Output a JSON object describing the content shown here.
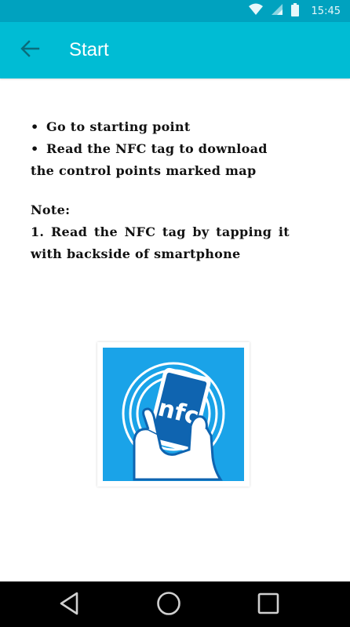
{
  "status_bar": {
    "time": "15:45",
    "icons": [
      "wifi-icon",
      "signal-icon",
      "battery-icon"
    ],
    "background": "#00a2bf"
  },
  "app_bar": {
    "title": "Start",
    "back_icon": "arrow-left-icon",
    "background": "#00bcd4"
  },
  "instructions": {
    "bullets": [
      {
        "bullet": "•",
        "line1": "Go to starting point",
        "line2": ""
      },
      {
        "bullet": "•",
        "line1": "Read the NFC tag to download",
        "line2": "the control points marked map"
      }
    ],
    "note_title": "Note:",
    "note_items": [
      "1. Read the NFC tag by tapping it with backside of smartphone"
    ]
  },
  "nfc_logo": {
    "text": "nfc",
    "background": "#1aa3e8"
  },
  "nav_bar": {
    "buttons": [
      "back-triangle-icon",
      "home-circle-icon",
      "recents-square-icon"
    ]
  }
}
